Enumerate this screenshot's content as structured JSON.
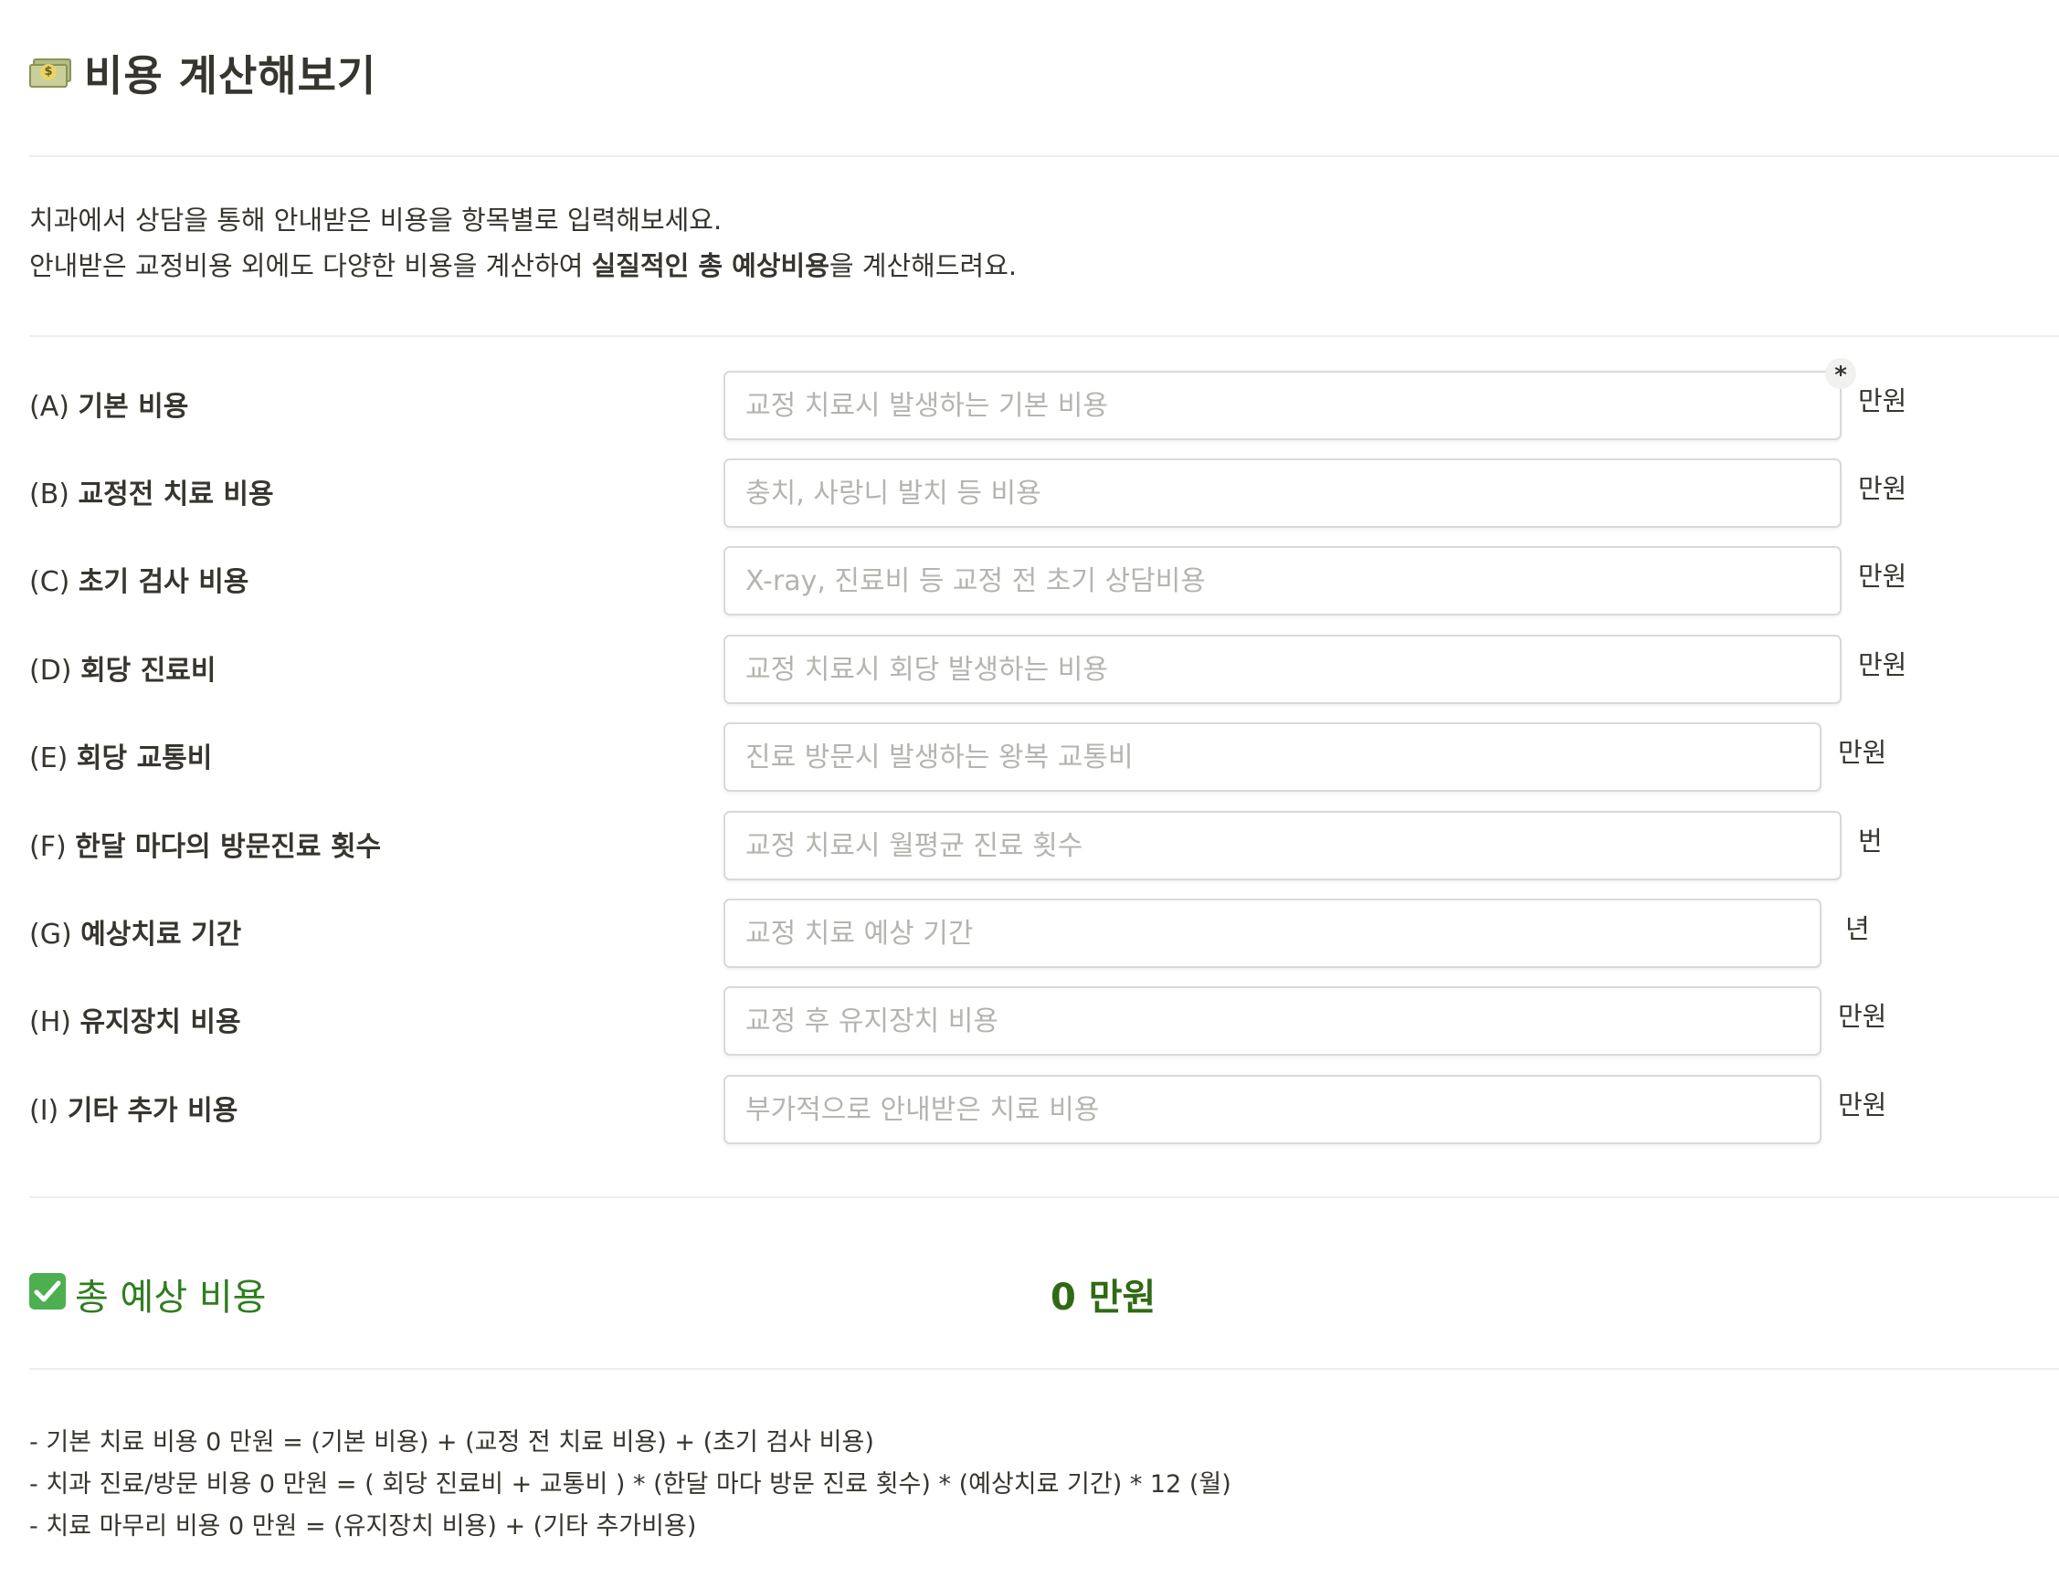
{
  "header": {
    "title": "비용 계산해보기",
    "icon": "money-bill-icon"
  },
  "intro": {
    "line1": "치과에서 상담을 통해 안내받은 비용을 항목별로 입력해보세요.",
    "line2_before": "안내받은 교정비용 외에도 다양한 비용을 계산하여 ",
    "line2_bold": "실질적인 총 예상비용",
    "line2_after": "을 계산해드려요."
  },
  "form": {
    "rows": [
      {
        "code": "(A)",
        "name": "기본 비용",
        "placeholder": "교정 치료시 발생하는 기본 비용",
        "unit": "만원",
        "required_mark": "*"
      },
      {
        "code": "(B)",
        "name": "교정전 치료 비용",
        "placeholder": "충치, 사랑니 발치 등 비용",
        "unit": "만원"
      },
      {
        "code": "(C)",
        "name": "초기 검사 비용",
        "placeholder": "X-ray, 진료비 등 교정 전 초기 상담비용",
        "unit": "만원"
      },
      {
        "code": "(D)",
        "name": "회당 진료비",
        "placeholder": "교정 치료시 회당 발생하는 비용",
        "unit": "만원"
      },
      {
        "code": "(E)",
        "name": "회당 교통비",
        "placeholder": "진료 방문시 발생하는 왕복 교통비",
        "unit": "만원"
      },
      {
        "code": "(F)",
        "name": "한달 마다의 방문진료 횟수",
        "placeholder": "교정 치료시 월평균 진료 횟수",
        "unit": "번"
      },
      {
        "code": "(G)",
        "name": "예상치료 기간",
        "placeholder": "교정 치료 예상 기간",
        "unit": "년"
      },
      {
        "code": "(H)",
        "name": "유지장치 비용",
        "placeholder": "교정 후 유지장치 비용",
        "unit": "만원"
      },
      {
        "code": "(I)",
        "name": "기타 추가 비용",
        "placeholder": "부가적으로 안내받은 치료 비용",
        "unit": "만원"
      }
    ]
  },
  "total": {
    "icon": "check-mark-icon",
    "label": "총 예상 비용",
    "value": "0 만원",
    "color": "#2f7d1f"
  },
  "formulas": [
    "- 기본 치료 비용 0 만원 = (기본 비용) + (교정 전 치료 비용) + (초기 검사 비용)",
    "- 치과 진료/방문 비용 0 만원 = ( 회당 진료비 + 교통비 )  * (한달 마다 방문 진료 횟수) * (예상치료 기간) * 12 (월)",
    "- 치료 마무리 비용 0 만원 = (유지장치 비용) + (기타 추가비용)"
  ]
}
